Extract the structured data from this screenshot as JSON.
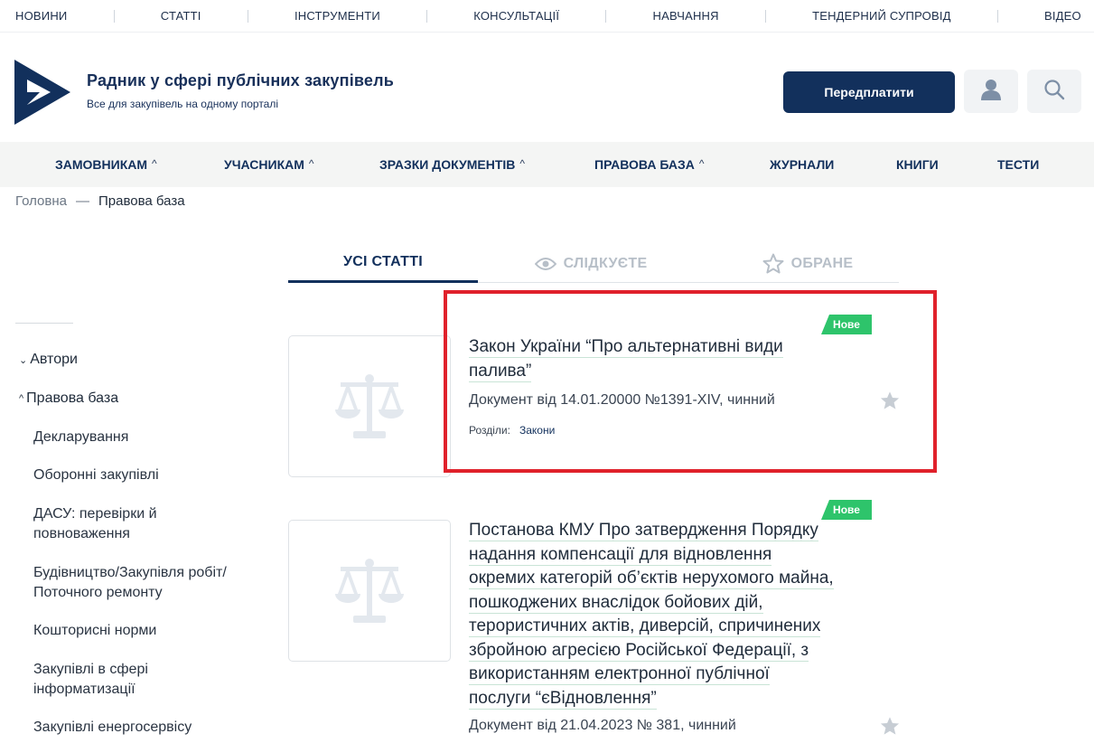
{
  "topnav": [
    "НОВИНИ",
    "СТАТТІ",
    "ІНСТРУМЕНТИ",
    "КОНСУЛЬТАЦІЇ",
    "НАВЧАННЯ",
    "ТЕНДЕРНИЙ СУПРОВІД",
    "ВІДЕО"
  ],
  "brand": {
    "title": "Радник у сфері публічних закупівель",
    "subtitle": "Все для закупівель на одному порталі",
    "logo_icon": "brand-logo-arrow-icon",
    "color": "#12305c"
  },
  "header": {
    "subscribe_label": "Передплатити",
    "profile_icon": "user-icon",
    "search_icon": "search-icon"
  },
  "mainnav": [
    {
      "label": "ЗАМОВНИКАМ",
      "caret": "^"
    },
    {
      "label": "УЧАСНИКАМ",
      "caret": "^"
    },
    {
      "label": "ЗРАЗКИ ДОКУМЕНТІВ",
      "caret": "^"
    },
    {
      "label": "ПРАВОВА БАЗА",
      "caret": "^"
    },
    {
      "label": "ЖУРНАЛИ",
      "caret": ""
    },
    {
      "label": "КНИГИ",
      "caret": ""
    },
    {
      "label": "ТЕСТИ",
      "caret": ""
    }
  ],
  "breadcrumb": {
    "home": "Головна",
    "separator": "—",
    "current": "Правова база"
  },
  "tabs": [
    {
      "label": "УСІ СТАТТІ",
      "active": true
    },
    {
      "label": "СЛІДКУЄТЕ",
      "active": false,
      "icon": "eye-icon"
    },
    {
      "label": "ОБРАНЕ",
      "active": false,
      "icon": "star-outline-icon"
    }
  ],
  "sidebar": {
    "top_items": [
      {
        "label": "Автори",
        "caret": "⌄"
      },
      {
        "label": "Правова база",
        "caret": "^"
      }
    ],
    "items": [
      "Декларування",
      "Оборонні закупівлі",
      "ДАСУ: перевірки й повноваження",
      "Будівництво/Закупівля робіт/ Поточного ремонту",
      "Кошторисні норми",
      "Закупівлі в сфері інформатизації",
      "Закупівлі енергосервісу"
    ]
  },
  "articles": [
    {
      "badge": "Нове",
      "title": "Закон України “Про альтернативні види палива”",
      "title_lines": [
        "Закон України “Про альтернативні види",
        "палива”"
      ],
      "meta": "Документ від 14.01.20000 №1391-XIV, чинний",
      "sections_label": "Розділи:",
      "section_link": "Закони",
      "highlighted": true
    },
    {
      "badge": "Нове",
      "title": "Постанова КМУ Про затвердження Порядку надання компенсації для відновлення окремих категорій об’єктів нерухомого майна, пошкоджених внаслідок бойових дій, терористичних актів, диверсій, спричинених збройною агресією Російської Федерації, з використанням електронної публічної послуги “єВідновлення”",
      "title_lines": [
        "Постанова КМУ Про затвердження Порядку",
        "надання компенсації для відновлення",
        "окремих категорій об’єктів нерухомого майна,",
        "пошкоджених внаслідок бойових дій,",
        "терористичних актів, диверсій, спричинених",
        "збройною агресією Російської Федерації, з",
        "використанням електронної публічної",
        "послуги “єВідновлення”"
      ],
      "meta": "Документ від 21.04.2023 № 381, чинний",
      "highlighted": false
    }
  ],
  "colors": {
    "accent": "#12305c",
    "badge": "#2ec46b",
    "highlight": "#e0212b"
  }
}
